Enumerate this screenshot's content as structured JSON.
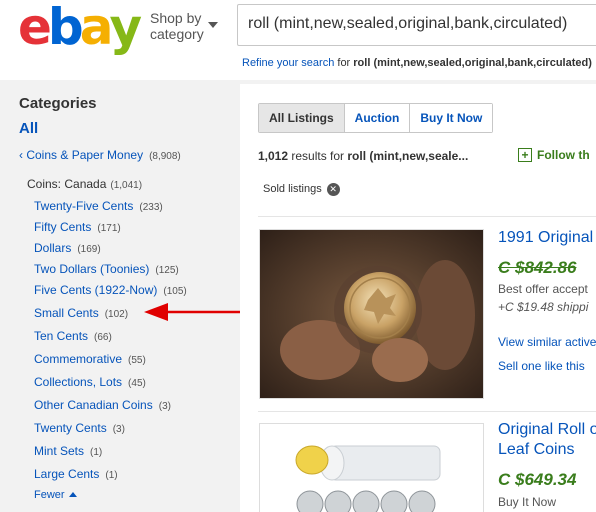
{
  "header": {
    "logo": [
      "e",
      "b",
      "a",
      "y"
    ],
    "logo_colors": [
      "#e53238",
      "#0064d2",
      "#f5af02",
      "#86b817"
    ],
    "shop_by_line1": "Shop by",
    "shop_by_line2": "category",
    "search_value": "roll (mint,new,sealed,original,bank,circulated)",
    "refine_link": "Refine your search",
    "refine_for": " for ",
    "refine_query": "roll (mint,new,sealed,original,bank,circulated)"
  },
  "sidebar": {
    "title": "Categories",
    "all": "All",
    "parent_label": "Coins & Paper Money",
    "parent_count": "(8,908)",
    "current_label": "Coins: Canada",
    "current_count": "(1,041)",
    "items": [
      {
        "label": "Twenty-Five Cents",
        "count": "(233)"
      },
      {
        "label": "Fifty Cents",
        "count": "(171)"
      },
      {
        "label": "Dollars",
        "count": "(169)"
      },
      {
        "label": "Two Dollars (Toonies)",
        "count": "(125)"
      },
      {
        "label": "Five Cents (1922-Now)",
        "count": "(105)"
      },
      {
        "label": "Small Cents",
        "count": "(102)"
      },
      {
        "label": "Ten Cents",
        "count": "(66)"
      },
      {
        "label": "Commemorative",
        "count": "(55)"
      },
      {
        "label": "Collections, Lots",
        "count": "(45)"
      },
      {
        "label": "Other Canadian Coins",
        "count": "(3)"
      },
      {
        "label": "Twenty Cents",
        "count": "(3)"
      },
      {
        "label": "Mint Sets",
        "count": "(1)"
      },
      {
        "label": "Large Cents",
        "count": "(1)"
      }
    ],
    "fewer": "Fewer"
  },
  "main": {
    "tabs": [
      "All Listings",
      "Auction",
      "Buy It Now"
    ],
    "results_count": "1,012",
    "results_text": " results for ",
    "results_query": "roll (mint,new,seale...",
    "follow": "Follow th",
    "sold_filter": "Sold listings",
    "listing1": {
      "title": "1991 Original",
      "price": "C $842.86",
      "line1": "Best offer accept",
      "shipping": "+C $19.48 shippi",
      "link1": "View similar active",
      "link2": "Sell one like this"
    },
    "listing2": {
      "title_line1": "Original Roll o",
      "title_line2": "Leaf Coins",
      "price": "C $649.34",
      "line1": "Buy It Now"
    }
  },
  "colors": {
    "link": "#0654ba",
    "price_green": "#3a7d1c",
    "arrow_red": "#e00000"
  }
}
